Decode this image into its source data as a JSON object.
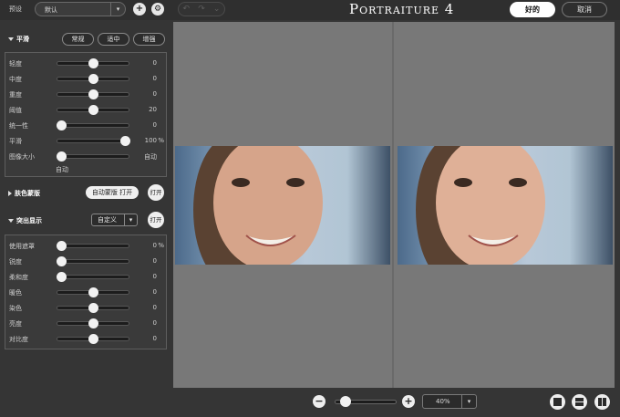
{
  "topbar": {
    "preset_label": "预设",
    "preset_value": "默认",
    "add_symbol": "+",
    "settings_symbol": "⚙",
    "undo_symbol": "↶",
    "redo_symbol": "↷",
    "history_symbol": "⌄",
    "title_main_p": "P",
    "title_main_rest": "ORTRAITURE",
    "title_version": " 4",
    "ok_label": "好的",
    "cancel_label": "取消"
  },
  "smoothing": {
    "title": "平滑",
    "presets": [
      "常规",
      "适中",
      "增强"
    ],
    "sliders": [
      {
        "label": "轻度",
        "value": "0",
        "unit": "",
        "fraction": 0.5
      },
      {
        "label": "中度",
        "value": "0",
        "unit": "",
        "fraction": 0.5
      },
      {
        "label": "重度",
        "value": "0",
        "unit": "",
        "fraction": 0.5
      },
      {
        "label": "阈值",
        "value": "20",
        "unit": "",
        "fraction": 0.5
      },
      {
        "label": "统一性",
        "value": "0",
        "unit": "",
        "fraction": 0.05
      },
      {
        "label": "平滑",
        "value": "100",
        "unit": "%",
        "fraction": 0.95
      },
      {
        "label": "图像大小",
        "value": "自动",
        "unit": "",
        "fraction": 0.05
      }
    ],
    "auto_note": "自动"
  },
  "skin_mask": {
    "title": "肤色蒙版",
    "auto_button": "自动蒙版 打开",
    "toggle": "打开"
  },
  "enhance": {
    "title": "突出显示",
    "mode_value": "自定义",
    "toggle": "打开",
    "sliders": [
      {
        "label": "使用遮罩",
        "value": "0",
        "unit": "%",
        "fraction": 0.05
      },
      {
        "label": "锐度",
        "value": "0",
        "unit": "",
        "fraction": 0.05
      },
      {
        "label": "柔和度",
        "value": "0",
        "unit": "",
        "fraction": 0.05
      },
      {
        "label": "暖色",
        "value": "0",
        "unit": "",
        "fraction": 0.5
      },
      {
        "label": "染色",
        "value": "0",
        "unit": "",
        "fraction": 0.5
      },
      {
        "label": "亮度",
        "value": "0",
        "unit": "",
        "fraction": 0.5
      },
      {
        "label": "对比度",
        "value": "0",
        "unit": "",
        "fraction": 0.5
      }
    ]
  },
  "bottombar": {
    "zoom_out_symbol": "−",
    "zoom_in_symbol": "+",
    "zoom_level": "40%",
    "zoom_fraction": 0.18,
    "dropdown_symbol": "▾"
  }
}
